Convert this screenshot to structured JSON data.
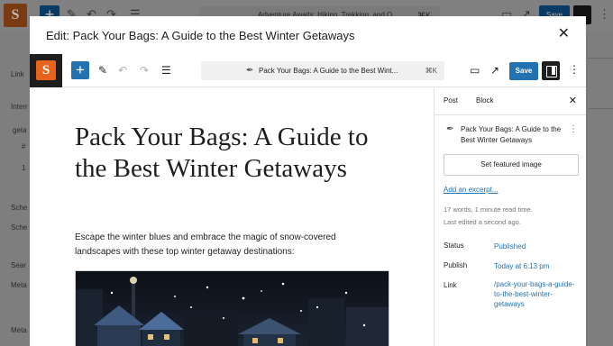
{
  "background": {
    "title": "Adventure Awaits: Hiking, Trekking, and O",
    "cmd": "⌘K",
    "save_label": "Save",
    "left_labels": [
      "Link",
      "Interr",
      "geta",
      "#",
      "1",
      "Sche",
      "Sche",
      "Sear",
      "Meta",
      "Meta"
    ]
  },
  "modal": {
    "title": "Edit: Pack Your Bags: A Guide to the Best Winter Getaways",
    "close_icon": "close-icon"
  },
  "editor": {
    "logo_letter": "S",
    "doc_title": "Pack Your Bags: A Guide to the Best Wint...",
    "cmd": "⌘K",
    "save_label": "Save"
  },
  "post": {
    "title": "Pack Your Bags: A Guide to the Best Winter Getaways",
    "excerpt": "Escape the winter blues and embrace the magic of snow-covered landscapes with these top winter getaway destinations:"
  },
  "sidebar": {
    "tab_post": "Post",
    "tab_block": "Block",
    "post_title": "Pack Your Bags: A Guide to the Best Winter Getaways",
    "featured_label": "Set featured image",
    "excerpt_link": "Add an excerpt...",
    "word_count": "17 words, 1 minute read time.",
    "last_edited": "Last edited a second ago.",
    "status_label": "Status",
    "status_value": "Published",
    "publish_label": "Publish",
    "publish_value": "Today at 6:13 pm",
    "link_label": "Link",
    "link_value": "/pack-your-bags-a-guide-to-the-best-winter-getaways"
  },
  "colors": {
    "accent": "#2271b1",
    "logo_orange": "#e8631c"
  }
}
